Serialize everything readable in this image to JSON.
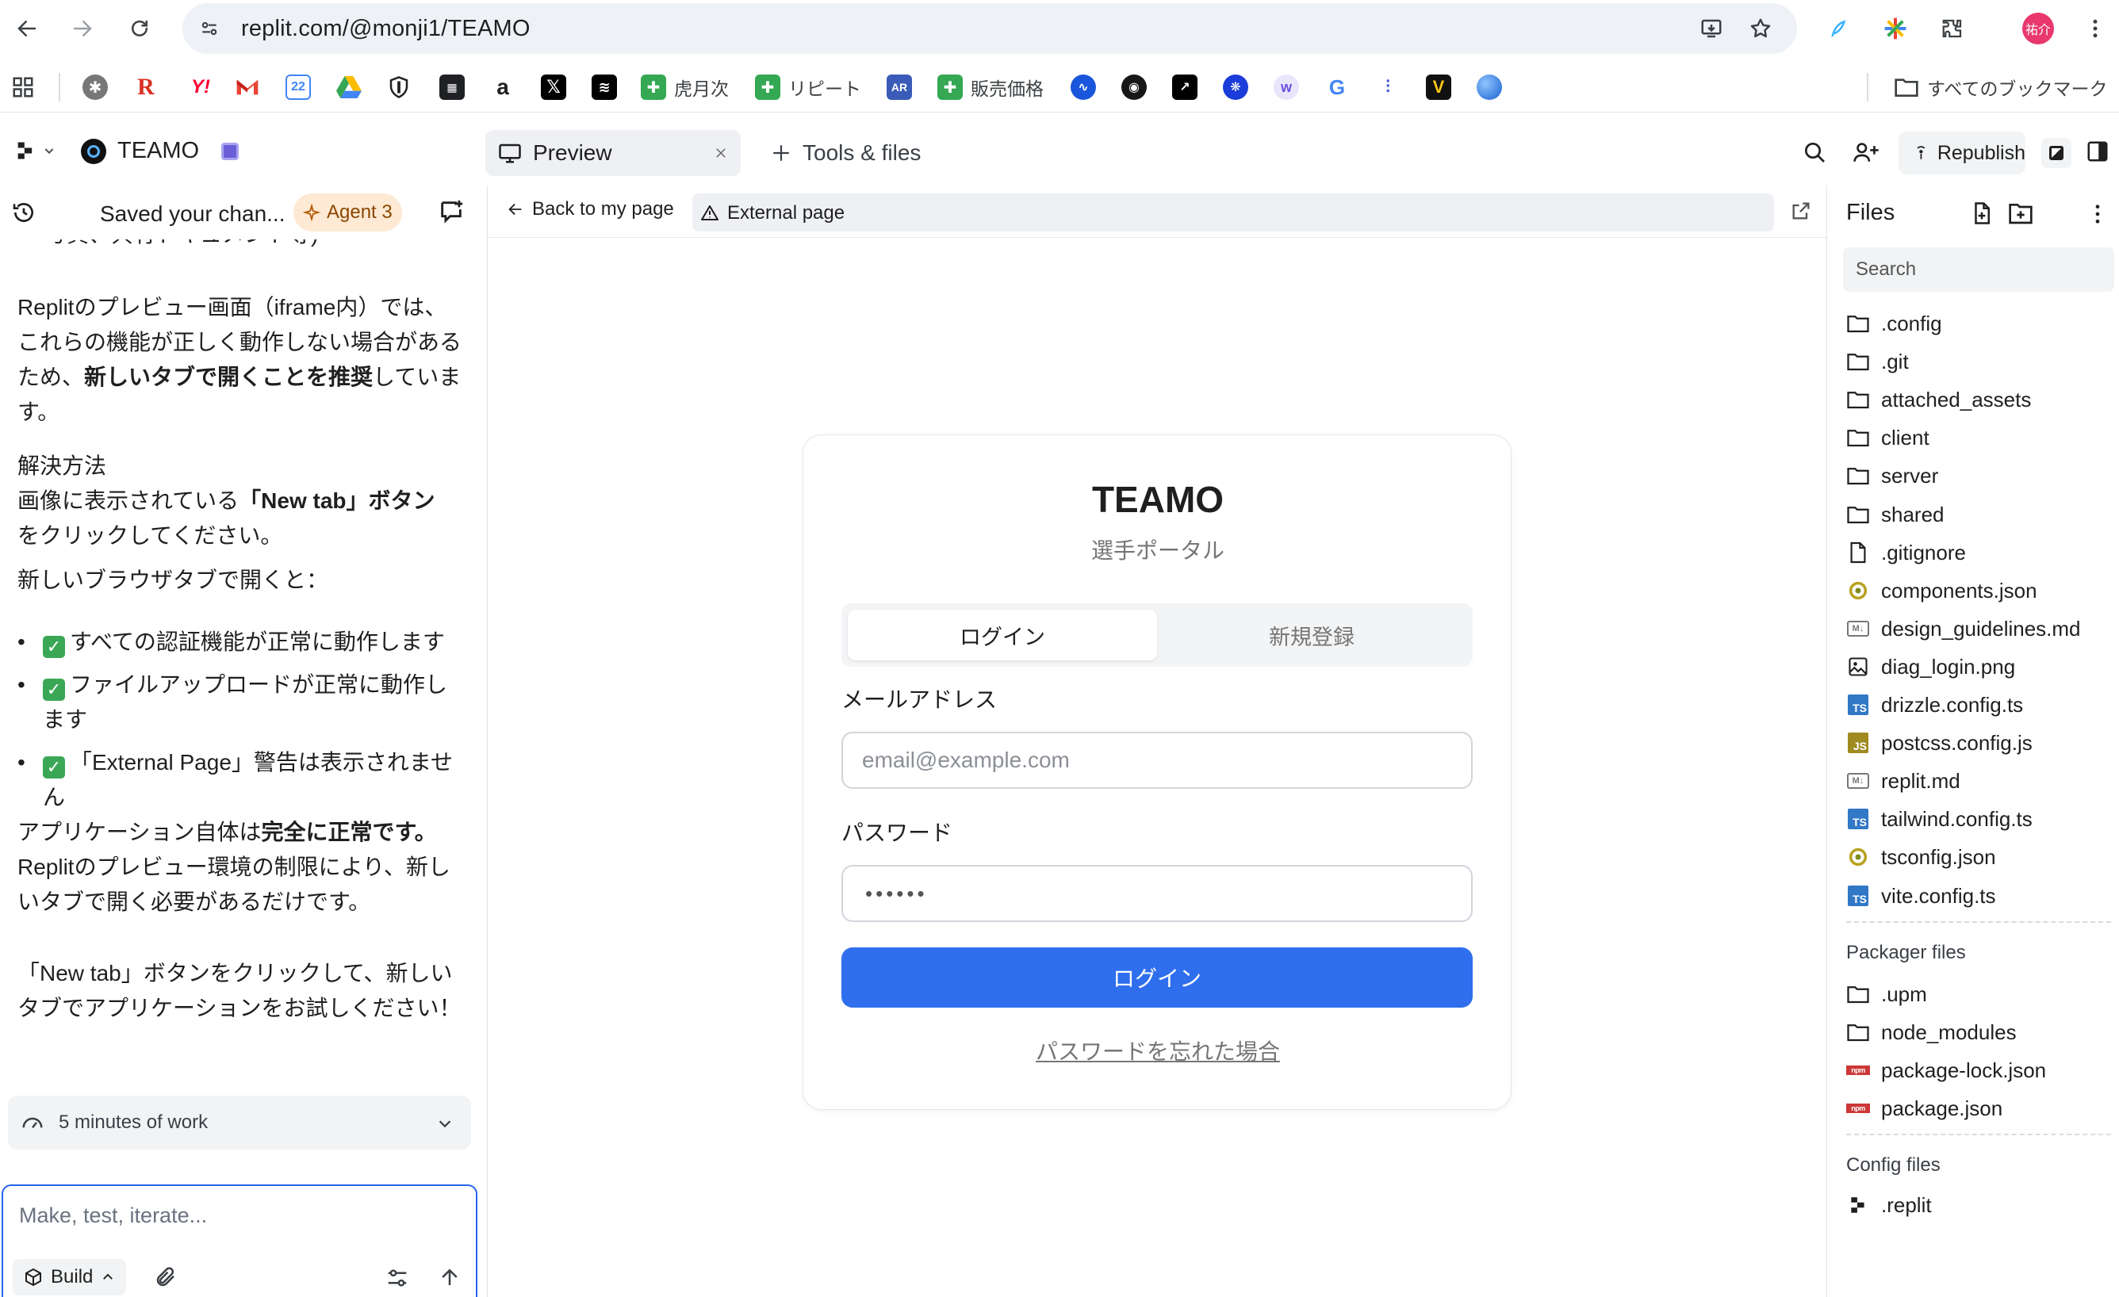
{
  "browser": {
    "url": "replit.com/@monji1/TEAMO",
    "profile_label": "祐介",
    "bookmarks": [
      {
        "label": "",
        "icon": "r-icon",
        "color": "#d93025",
        "glyph": "R"
      },
      {
        "label": "",
        "icon": "yahoo-icon",
        "color": "#ff0033",
        "glyph": "Y!"
      },
      {
        "label": "虎月次",
        "icon": "plus-sheet-icon",
        "color": "#34a853"
      },
      {
        "label": "リピート",
        "icon": "plus-sheet-icon",
        "color": "#34a853"
      },
      {
        "label": "販売価格",
        "icon": "plus-sheet-icon",
        "color": "#34a853"
      }
    ],
    "calendar_day": "22",
    "all_bookmarks_label": "すべてのブックマーク"
  },
  "header": {
    "project_name": "TEAMO",
    "tab_preview": "Preview",
    "tab_tools": "Tools & files",
    "republish_label": "Republish"
  },
  "chat": {
    "status_text": "Saved your chan...",
    "agent_badge": "Agent 3",
    "clipped_line": "写真、共有ドキュメント等)",
    "p1_a": "Replitのプレビュー画面（iframe内）では、",
    "p1_b": "これらの機能が正しく動作しない場合がある",
    "p1_c_pre": "ため、",
    "p1_c_bold": "新しいタブで開くことを推奨",
    "p1_c_post": "していま",
    "p1_d": "す。",
    "p2_title": "解決方法",
    "p2_a_pre": "画像に表示されている",
    "p2_a_bold": "「New tab」ボタン",
    "p2_b": "をクリックしてください。",
    "p3": "新しいブラウザタブで開くと：",
    "bullets": [
      {
        "a": "すべての認証機能が正常に動作します",
        "b": ""
      },
      {
        "a": "ファイルアップロードが正常に動作し",
        "b": "ます"
      },
      {
        "a": "「External Page」警告は表示されませ",
        "b": "ん"
      }
    ],
    "p4_pre": "アプリケーション自体は",
    "p4_bold": "完全に正常です。",
    "p4_b": "Replitのプレビュー環境の制限により、新し",
    "p4_c": "いタブで開く必要があるだけです。",
    "p5_a": "「New tab」ボタンをクリックして、新しい",
    "p5_b": "タブでアプリケーションをお試しください！",
    "work_label": "5 minutes of work",
    "input_placeholder": "Make, test, iterate...",
    "build_label": "Build"
  },
  "preview": {
    "back_label": "Back to my page",
    "external_label": "External page",
    "app_title": "TEAMO",
    "app_subtitle": "選手ポータル",
    "tab_login": "ログイン",
    "tab_register": "新規登録",
    "email_label": "メールアドレス",
    "email_placeholder": "email@example.com",
    "password_label": "パスワード",
    "password_value": "••••••",
    "login_button": "ログイン",
    "forgot_link": "パスワードを忘れた場合",
    "primary_color": "#2f6fed"
  },
  "files": {
    "title": "Files",
    "search_placeholder": "Search",
    "items": [
      {
        "name": ".config",
        "type": "folder"
      },
      {
        "name": ".git",
        "type": "folder"
      },
      {
        "name": "attached_assets",
        "type": "folder"
      },
      {
        "name": "client",
        "type": "folder"
      },
      {
        "name": "server",
        "type": "folder"
      },
      {
        "name": "shared",
        "type": "folder"
      },
      {
        "name": ".gitignore",
        "type": "file"
      },
      {
        "name": "components.json",
        "type": "json"
      },
      {
        "name": "design_guidelines.md",
        "type": "md"
      },
      {
        "name": "diag_login.png",
        "type": "image"
      },
      {
        "name": "drizzle.config.ts",
        "type": "ts"
      },
      {
        "name": "postcss.config.js",
        "type": "js"
      },
      {
        "name": "replit.md",
        "type": "md"
      },
      {
        "name": "tailwind.config.ts",
        "type": "ts"
      },
      {
        "name": "tsconfig.json",
        "type": "json"
      },
      {
        "name": "vite.config.ts",
        "type": "ts"
      }
    ],
    "packager_title": "Packager files",
    "packager_items": [
      {
        "name": ".upm",
        "type": "folder"
      },
      {
        "name": "node_modules",
        "type": "folder"
      },
      {
        "name": "package-lock.json",
        "type": "npm"
      },
      {
        "name": "package.json",
        "type": "npm"
      }
    ],
    "config_title": "Config files",
    "config_items": [
      {
        "name": ".replit",
        "type": "replit"
      }
    ]
  }
}
